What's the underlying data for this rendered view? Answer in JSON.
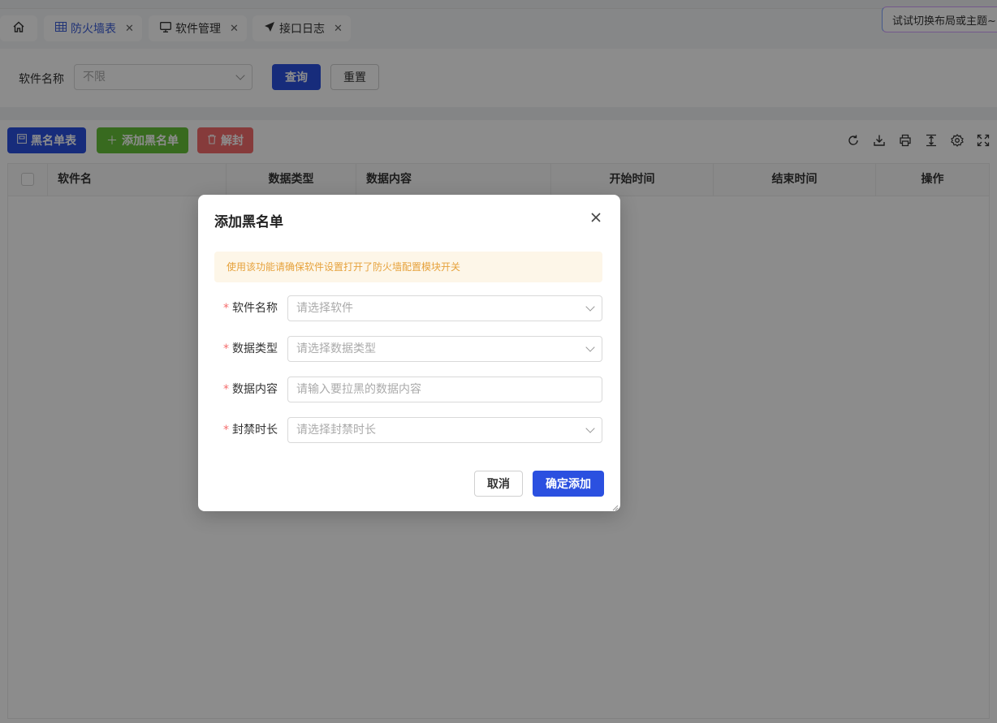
{
  "tabs": {
    "home_icon": "home-icon",
    "items": [
      {
        "label": "防火墙表",
        "icon": "table-icon"
      },
      {
        "label": "软件管理",
        "icon": "monitor-icon"
      },
      {
        "label": "接口日志",
        "icon": "send-icon"
      }
    ],
    "tip": "试试切换布局或主题~"
  },
  "search": {
    "label": "软件名称",
    "select_value": "不限",
    "query_button": "查询",
    "reset_button": "重置"
  },
  "toolbar": {
    "blacklist_button": "黑名单表",
    "add_button": "添加黑名单",
    "unban_button": "解封",
    "colors": {
      "blue": "#2b50e0",
      "green": "#67c23a",
      "red": "#f56c6c"
    }
  },
  "table": {
    "columns": [
      "软件名",
      "数据类型",
      "数据内容",
      "开始时间",
      "结束时间",
      "操作"
    ]
  },
  "dialog": {
    "title": "添加黑名单",
    "alert": "使用该功能请确保软件设置打开了防火墙配置模块开关",
    "fields": [
      {
        "label": "软件名称",
        "placeholder": "请选择软件"
      },
      {
        "label": "数据类型",
        "placeholder": "请选择数据类型"
      },
      {
        "label": "数据内容",
        "placeholder": "请输入要拉黑的数据内容"
      },
      {
        "label": "封禁时长",
        "placeholder": "请选择封禁时长"
      }
    ],
    "cancel_button": "取消",
    "confirm_button": "确定添加"
  }
}
